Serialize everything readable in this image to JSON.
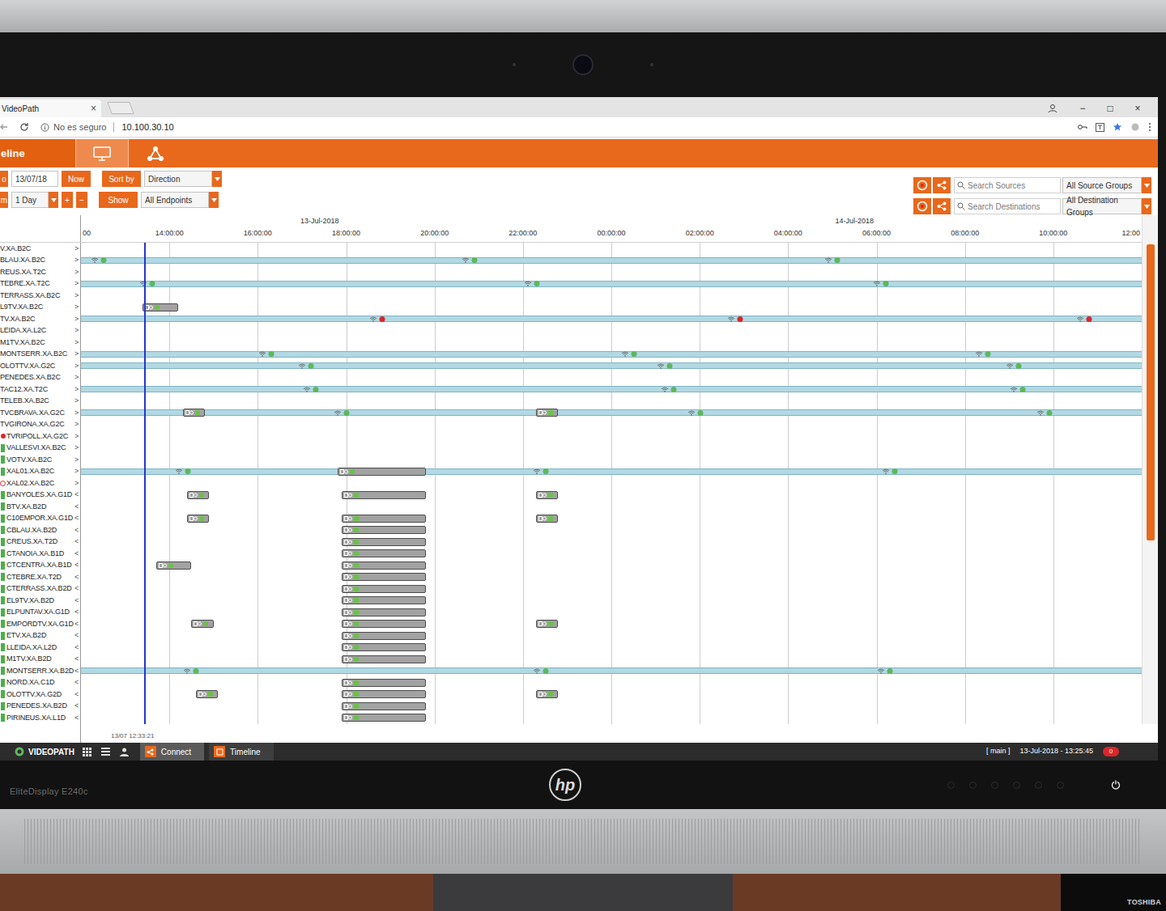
{
  "monitor": {
    "model": "EliteDisplay E240c",
    "logo": "hp",
    "desk_device": "TOSHIBA"
  },
  "browser": {
    "tab_title": "VideoPath",
    "tab_close": "×",
    "security": "No es seguro",
    "url": "10.100.30.10",
    "window_buttons": [
      "−",
      "□",
      "×"
    ]
  },
  "app_header": {
    "title": "eline"
  },
  "toolbar": {
    "row1": {
      "prefix": "o",
      "date": "13/07/18",
      "now": "Now",
      "sort_label": "Sort by",
      "sort_value": "Direction"
    },
    "row2": {
      "prefix": "m",
      "range": "1 Day",
      "plus": "+",
      "minus": "−",
      "show_label": "Show",
      "show_value": "All Endpoints"
    }
  },
  "filters": [
    {
      "placeholder": "Search Sources",
      "group": "All Source Groups"
    },
    {
      "placeholder": "Search Destinations",
      "group": "All Destination Groups"
    }
  ],
  "axis": {
    "dates": [
      {
        "label": "13-Jul-2018",
        "hour": 5.4
      },
      {
        "label": "14-Jul-2018",
        "hour": 17.5
      }
    ],
    "ticks": [
      {
        "label": "00",
        "hour": 0
      },
      {
        "label": "14:00:00",
        "hour": 2
      },
      {
        "label": "16:00:00",
        "hour": 4
      },
      {
        "label": "18:00:00",
        "hour": 6
      },
      {
        "label": "20:00:00",
        "hour": 8
      },
      {
        "label": "22:00:00",
        "hour": 10
      },
      {
        "label": "00:00:00",
        "hour": 12
      },
      {
        "label": "02:00:00",
        "hour": 14
      },
      {
        "label": "04:00:00",
        "hour": 16
      },
      {
        "label": "06:00:00",
        "hour": 18
      },
      {
        "label": "08:00:00",
        "hour": 20
      },
      {
        "label": "10:00:00",
        "hour": 22
      },
      {
        "label": "12:00",
        "hour": 24
      }
    ],
    "span_hours": 24,
    "now_hour": 1.42
  },
  "scrollbar": {
    "level": 0.62
  },
  "rows": [
    {
      "label": "V.XA.B2C",
      "arrow": ">",
      "flag": null,
      "events": []
    },
    {
      "label": "BLAU.XA.B2C",
      "arrow": ">",
      "flag": null,
      "events": [
        {
          "kind": "band"
        },
        {
          "kind": "marker",
          "hour": 0.4,
          "color": "#5cb85c"
        },
        {
          "kind": "marker",
          "hour": 8.8,
          "color": "#5cb85c"
        },
        {
          "kind": "marker",
          "hour": 17.0,
          "color": "#5cb85c"
        }
      ]
    },
    {
      "label": "REUS.XA.T2C",
      "arrow": ">",
      "flag": null,
      "events": []
    },
    {
      "label": "TEBRE.XA.T2C",
      "arrow": ">",
      "flag": null,
      "events": [
        {
          "kind": "band"
        },
        {
          "kind": "marker",
          "hour": 1.5,
          "color": "#5cb85c"
        },
        {
          "kind": "marker",
          "hour": 10.2,
          "color": "#5cb85c"
        },
        {
          "kind": "marker",
          "hour": 18.1,
          "color": "#5cb85c"
        }
      ]
    },
    {
      "label": "TERRASS.XA.B2C",
      "arrow": ">",
      "flag": null,
      "events": []
    },
    {
      "label": "L9TV.XA.B2C",
      "arrow": ">",
      "flag": null,
      "events": [
        {
          "kind": "block",
          "start": 1.4,
          "end": 2.2
        }
      ]
    },
    {
      "label": "TV.XA.B2C",
      "arrow": ">",
      "flag": null,
      "events": [
        {
          "kind": "band"
        },
        {
          "kind": "marker",
          "hour": 6.7,
          "color": "#d9262b"
        },
        {
          "kind": "marker",
          "hour": 14.8,
          "color": "#d9262b"
        },
        {
          "kind": "marker",
          "hour": 22.7,
          "color": "#d9262b"
        }
      ]
    },
    {
      "label": "LEIDA.XA.L2C",
      "arrow": ">",
      "flag": null,
      "events": []
    },
    {
      "label": "M1TV.XA.B2C",
      "arrow": ">",
      "flag": null,
      "events": []
    },
    {
      "label": "MONTSERR.XA.B2C",
      "arrow": ">",
      "flag": null,
      "events": [
        {
          "kind": "band"
        },
        {
          "kind": "marker",
          "hour": 4.2,
          "color": "#5cb85c"
        },
        {
          "kind": "marker",
          "hour": 12.4,
          "color": "#5cb85c"
        },
        {
          "kind": "marker",
          "hour": 20.4,
          "color": "#5cb85c"
        }
      ]
    },
    {
      "label": "OLOTTV.XA.G2C",
      "arrow": ">",
      "flag": null,
      "events": [
        {
          "kind": "band"
        },
        {
          "kind": "marker",
          "hour": 5.1,
          "color": "#5cb85c"
        },
        {
          "kind": "marker",
          "hour": 13.2,
          "color": "#5cb85c"
        },
        {
          "kind": "marker",
          "hour": 21.1,
          "color": "#5cb85c"
        }
      ]
    },
    {
      "label": "PENEDES.XA.B2C",
      "arrow": ">",
      "flag": null,
      "events": []
    },
    {
      "label": "TAC12.XA.T2C",
      "arrow": ">",
      "flag": null,
      "events": [
        {
          "kind": "band"
        },
        {
          "kind": "marker",
          "hour": 5.2,
          "color": "#5cb85c"
        },
        {
          "kind": "marker",
          "hour": 13.3,
          "color": "#5cb85c"
        },
        {
          "kind": "marker",
          "hour": 21.2,
          "color": "#5cb85c"
        }
      ]
    },
    {
      "label": "TELEB.XA.B2C",
      "arrow": ">",
      "flag": null,
      "events": []
    },
    {
      "label": "TVCBRAVA.XA.G2C",
      "arrow": ">",
      "flag": null,
      "events": [
        {
          "kind": "band"
        },
        {
          "kind": "block",
          "start": 2.3,
          "end": 2.8
        },
        {
          "kind": "marker",
          "hour": 5.9,
          "color": "#5cb85c"
        },
        {
          "kind": "block",
          "start": 10.3,
          "end": 10.8
        },
        {
          "kind": "marker",
          "hour": 13.9,
          "color": "#5cb85c"
        },
        {
          "kind": "marker",
          "hour": 21.8,
          "color": "#5cb85c"
        }
      ]
    },
    {
      "label": "TVGIRONA.XA.G2C",
      "arrow": ">",
      "flag": null,
      "events": []
    },
    {
      "label": "TVRIPOLL.XA.G2C",
      "arrow": ">",
      "flag": {
        "kind": "dot",
        "color": "#d9262b"
      },
      "events": []
    },
    {
      "label": "VALLESVI.XA.B2C",
      "arrow": ">",
      "flag": {
        "kind": "square",
        "color": "#4caf50"
      },
      "events": []
    },
    {
      "label": "VOTV.XA.B2C",
      "arrow": ">",
      "flag": {
        "kind": "square",
        "color": "#4caf50"
      },
      "events": []
    },
    {
      "label": "XAL01.XA.B2C",
      "arrow": ">",
      "flag": {
        "kind": "square",
        "color": "#4caf50"
      },
      "events": [
        {
          "kind": "band"
        },
        {
          "kind": "marker",
          "hour": 2.3,
          "color": "#5cb85c"
        },
        {
          "kind": "block",
          "start": 5.8,
          "end": 7.8
        },
        {
          "kind": "marker",
          "hour": 10.4,
          "color": "#5cb85c"
        },
        {
          "kind": "marker",
          "hour": 18.3,
          "color": "#5cb85c"
        }
      ]
    },
    {
      "label": "XAL02.XA.B2C",
      "arrow": ">",
      "flag": {
        "kind": "blocked",
        "color": "#d9262b"
      },
      "events": []
    },
    {
      "label": "BANYOLES.XA.G1D",
      "arrow": "<",
      "flag": {
        "kind": "square",
        "color": "#4caf50"
      },
      "events": [
        {
          "kind": "block",
          "start": 2.4,
          "end": 2.9
        },
        {
          "kind": "block",
          "start": 5.9,
          "end": 7.8
        },
        {
          "kind": "block",
          "start": 10.3,
          "end": 10.8
        }
      ]
    },
    {
      "label": "BTV.XA.B2D",
      "arrow": "<",
      "flag": {
        "kind": "square",
        "color": "#4caf50"
      },
      "events": []
    },
    {
      "label": "C10EMPOR.XA.G1D",
      "arrow": "<",
      "flag": {
        "kind": "square",
        "color": "#4caf50"
      },
      "events": [
        {
          "kind": "block",
          "start": 2.4,
          "end": 2.9
        },
        {
          "kind": "block",
          "start": 5.9,
          "end": 7.8
        },
        {
          "kind": "block",
          "start": 10.3,
          "end": 10.8
        }
      ]
    },
    {
      "label": "CBLAU.XA.B2D",
      "arrow": "<",
      "flag": {
        "kind": "square",
        "color": "#4caf50"
      },
      "events": [
        {
          "kind": "block",
          "start": 5.9,
          "end": 7.8
        }
      ]
    },
    {
      "label": "CREUS.XA.T2D",
      "arrow": "<",
      "flag": {
        "kind": "square",
        "color": "#4caf50"
      },
      "events": [
        {
          "kind": "block",
          "start": 5.9,
          "end": 7.8
        }
      ]
    },
    {
      "label": "CTANOIA.XA.B1D",
      "arrow": "<",
      "flag": {
        "kind": "square",
        "color": "#4caf50"
      },
      "events": [
        {
          "kind": "block",
          "start": 5.9,
          "end": 7.8
        }
      ]
    },
    {
      "label": "CTCENTRA.XA.B1D",
      "arrow": "<",
      "flag": {
        "kind": "square",
        "color": "#4caf50"
      },
      "events": [
        {
          "kind": "block",
          "start": 1.7,
          "end": 2.5
        },
        {
          "kind": "block",
          "start": 5.9,
          "end": 7.8
        }
      ]
    },
    {
      "label": "CTEBRE.XA.T2D",
      "arrow": "<",
      "flag": {
        "kind": "square",
        "color": "#4caf50"
      },
      "events": [
        {
          "kind": "block",
          "start": 5.9,
          "end": 7.8
        }
      ]
    },
    {
      "label": "CTERRASS.XA.B2D",
      "arrow": "<",
      "flag": {
        "kind": "square",
        "color": "#4caf50"
      },
      "events": [
        {
          "kind": "block",
          "start": 5.9,
          "end": 7.8
        }
      ]
    },
    {
      "label": "EL9TV.XA.B2D",
      "arrow": "<",
      "flag": {
        "kind": "square",
        "color": "#4caf50"
      },
      "events": [
        {
          "kind": "block",
          "start": 5.9,
          "end": 7.8
        }
      ]
    },
    {
      "label": "ELPUNTAV.XA.G1D",
      "arrow": "<",
      "flag": {
        "kind": "square",
        "color": "#4caf50"
      },
      "events": [
        {
          "kind": "block",
          "start": 5.9,
          "end": 7.8
        }
      ]
    },
    {
      "label": "EMPORDTV.XA.G1D",
      "arrow": "<",
      "flag": {
        "kind": "square",
        "color": "#4caf50"
      },
      "events": [
        {
          "kind": "block",
          "start": 2.5,
          "end": 3.0
        },
        {
          "kind": "block",
          "start": 5.9,
          "end": 7.8
        },
        {
          "kind": "block",
          "start": 10.3,
          "end": 10.8
        }
      ]
    },
    {
      "label": "ETV.XA.B2D",
      "arrow": "<",
      "flag": {
        "kind": "square",
        "color": "#4caf50"
      },
      "events": [
        {
          "kind": "block",
          "start": 5.9,
          "end": 7.8
        }
      ]
    },
    {
      "label": "LLEIDA.XA.L2D",
      "arrow": "<",
      "flag": {
        "kind": "square",
        "color": "#4caf50"
      },
      "events": [
        {
          "kind": "block",
          "start": 5.9,
          "end": 7.8
        }
      ]
    },
    {
      "label": "M1TV.XA.B2D",
      "arrow": "<",
      "flag": {
        "kind": "square",
        "color": "#4caf50"
      },
      "events": [
        {
          "kind": "block",
          "start": 5.9,
          "end": 7.8
        }
      ]
    },
    {
      "label": "MONTSERR.XA.B2D",
      "arrow": "<",
      "flag": {
        "kind": "square",
        "color": "#4caf50"
      },
      "events": [
        {
          "kind": "band"
        },
        {
          "kind": "marker",
          "hour": 2.5,
          "color": "#5cb85c"
        },
        {
          "kind": "marker",
          "hour": 10.4,
          "color": "#5cb85c"
        },
        {
          "kind": "marker",
          "hour": 18.2,
          "color": "#5cb85c"
        }
      ]
    },
    {
      "label": "NORD.XA.C1D",
      "arrow": "<",
      "flag": {
        "kind": "square",
        "color": "#4caf50"
      },
      "events": [
        {
          "kind": "block",
          "start": 5.9,
          "end": 7.8
        }
      ]
    },
    {
      "label": "OLOTTV.XA.G2D",
      "arrow": "<",
      "flag": {
        "kind": "square",
        "color": "#4caf50"
      },
      "events": [
        {
          "kind": "block",
          "start": 2.6,
          "end": 3.1
        },
        {
          "kind": "block",
          "start": 5.9,
          "end": 7.8
        },
        {
          "kind": "block",
          "start": 10.3,
          "end": 10.8
        }
      ]
    },
    {
      "label": "PENEDES.XA.B2D",
      "arrow": "<",
      "flag": {
        "kind": "square",
        "color": "#4caf50"
      },
      "events": [
        {
          "kind": "block",
          "start": 5.9,
          "end": 7.8
        }
      ]
    },
    {
      "label": "PIRINEUS.XA.L1D",
      "arrow": "<",
      "flag": {
        "kind": "square",
        "color": "#4caf50"
      },
      "events": [
        {
          "kind": "block",
          "start": 5.9,
          "end": 7.8
        }
      ]
    }
  ],
  "status": {
    "timestamp": "13/07 12:33:21"
  },
  "taskbar": {
    "app": "VIDEOPATH",
    "items": [
      {
        "label": "Connect"
      },
      {
        "label": "Timeline"
      }
    ],
    "context": "[ main ]",
    "clock": "13-Jul-2018 - 13:25:45",
    "alerts": "0"
  }
}
